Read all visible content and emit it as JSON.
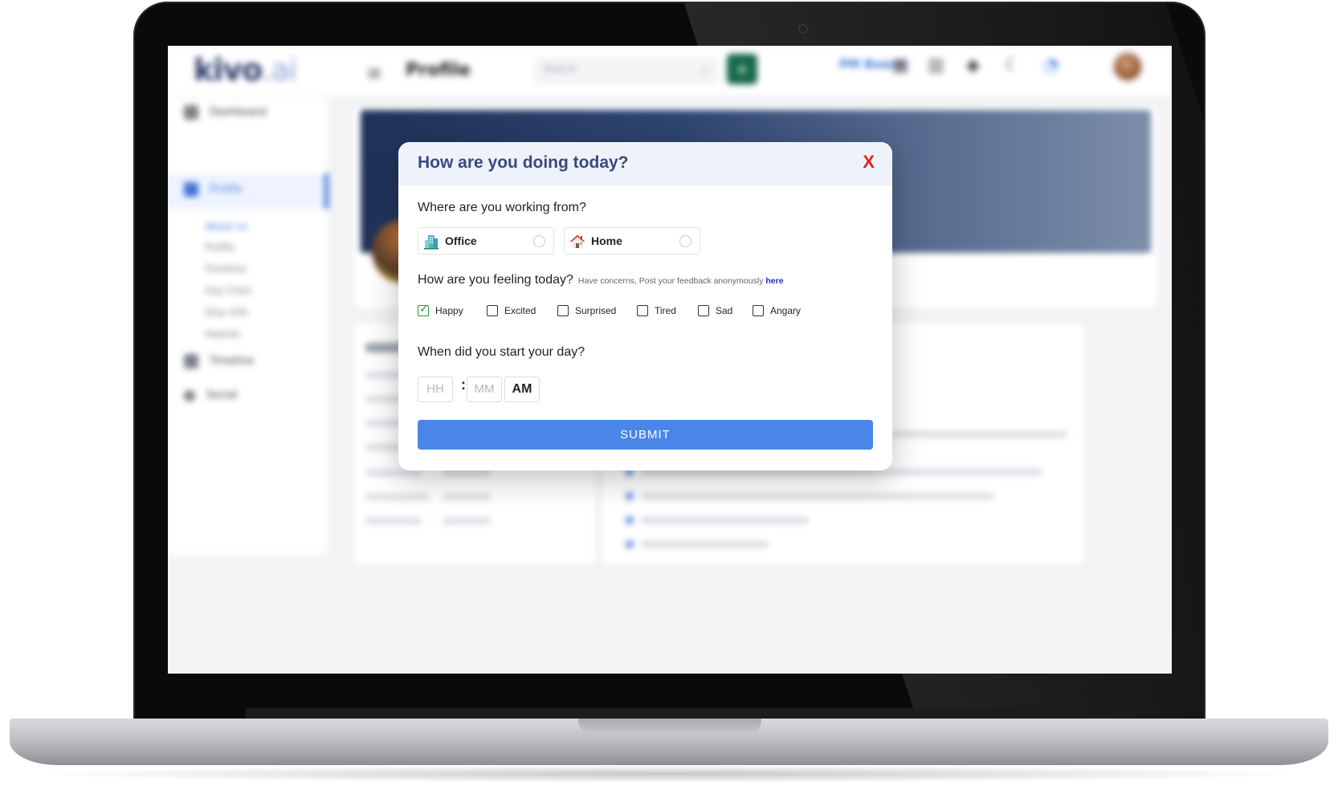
{
  "app": {
    "logo_main": "kivo",
    "logo_suffix": ".ai",
    "page_title": "Profile",
    "search_placeholder": "Search",
    "add_label": "+",
    "pm_board": "PM Board"
  },
  "sidebar": {
    "items": [
      {
        "label": "Dashboard"
      },
      {
        "label": "Profile"
      },
      {
        "label": "Timeline"
      },
      {
        "label": "Social"
      }
    ],
    "sub_items": [
      "About us",
      "Profile",
      "Timeline",
      "Org Chart",
      "Stay Info",
      "Awards"
    ]
  },
  "modal": {
    "title": "How are you doing today?",
    "close_label": "X",
    "q_location": "Where are you working from?",
    "locations": [
      {
        "label": "Office",
        "icon": "office-building-icon"
      },
      {
        "label": "Home",
        "icon": "house-icon"
      }
    ],
    "q_feeling": "How are you feeling today?",
    "feeling_hint": "Have concerns, Post your feedback anonymously",
    "feeling_hint_link": "here",
    "moods": [
      {
        "label": "Happy",
        "checked": true
      },
      {
        "label": "Excited",
        "checked": false
      },
      {
        "label": "Surprised",
        "checked": false
      },
      {
        "label": "Tired",
        "checked": false
      },
      {
        "label": "Sad",
        "checked": false
      },
      {
        "label": "Angary",
        "checked": false
      }
    ],
    "q_start": "When did you start your day?",
    "hour_placeholder": "HH",
    "minute_placeholder": "MM",
    "separator": ":",
    "meridiem": "AM",
    "submit_label": "SUBMIT"
  },
  "colors": {
    "accent": "#4a86e8",
    "title": "#3c4780",
    "close": "#e0231f",
    "brand_green": "#17694a",
    "check_green": "#3a8f3a"
  }
}
